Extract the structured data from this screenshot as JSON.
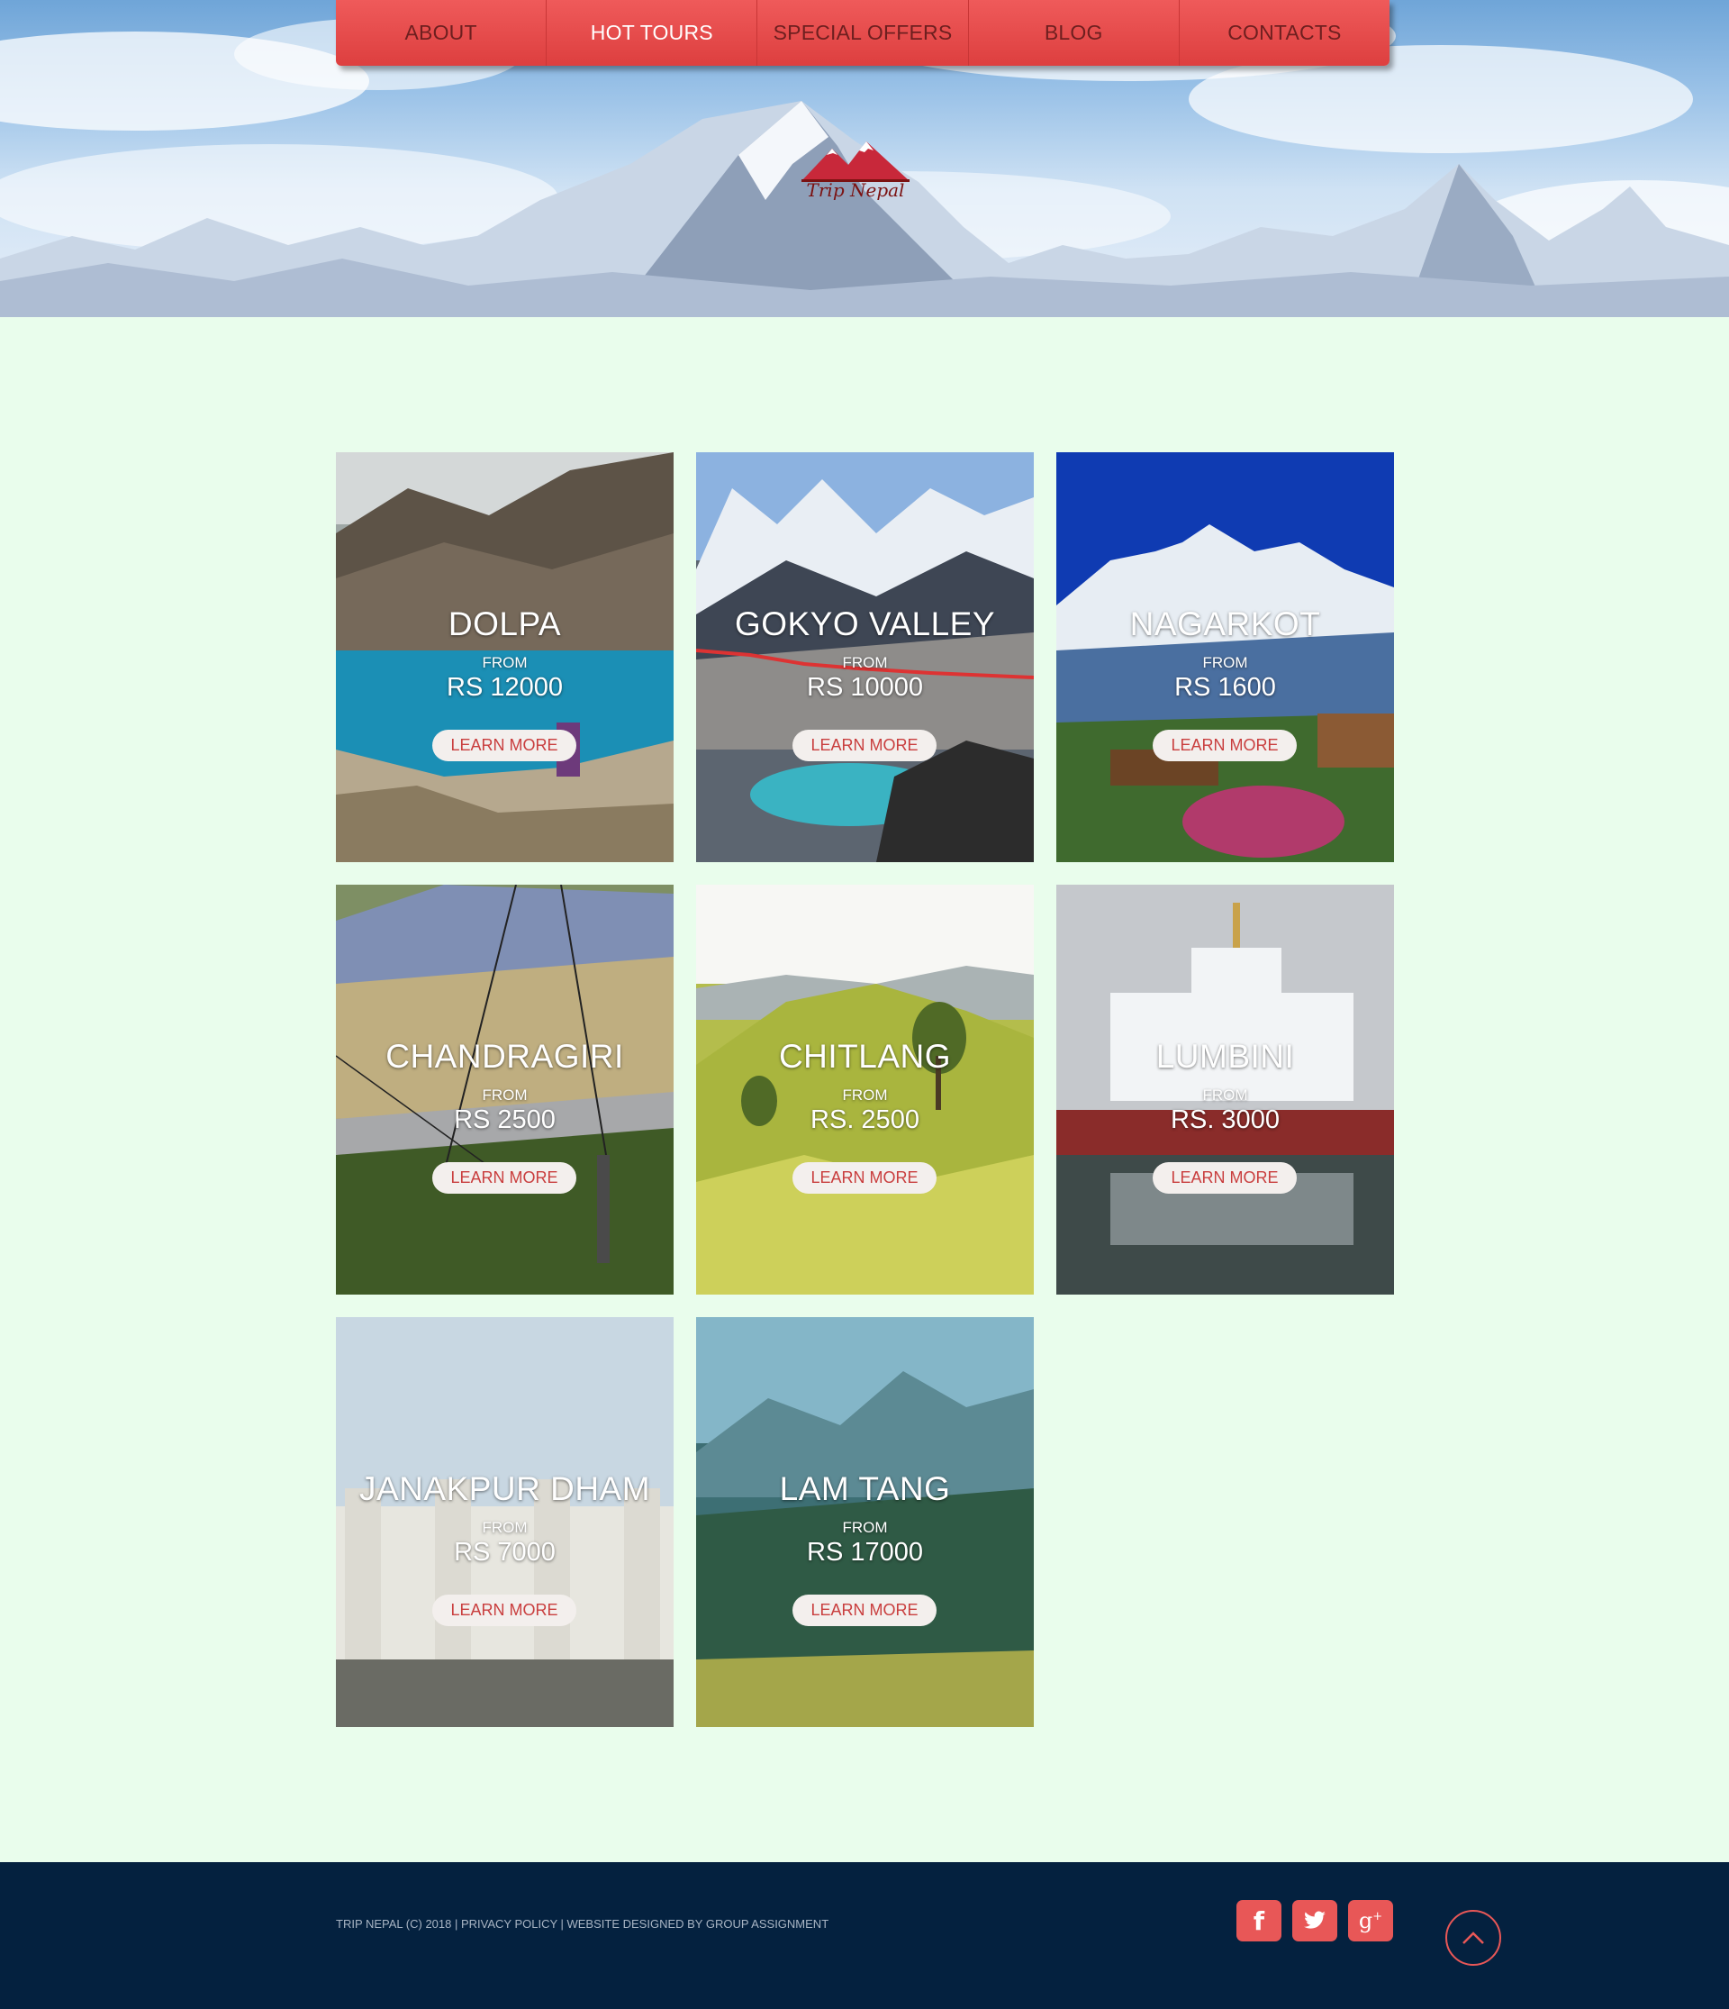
{
  "nav": {
    "items": [
      {
        "label": "ABOUT",
        "active": false
      },
      {
        "label": "HOT TOURS",
        "active": true
      },
      {
        "label": "SPECIAL OFFERS",
        "active": false
      },
      {
        "label": "BLOG",
        "active": false
      },
      {
        "label": "CONTACTS",
        "active": false
      }
    ]
  },
  "logo": {
    "text": "Trip Nepal",
    "icon": "mountain-logo-icon",
    "color": "#c8283a"
  },
  "tours": [
    {
      "title": "DOLPA",
      "from": "FROM",
      "price": "RS 12000",
      "button": "LEARN MORE"
    },
    {
      "title": "GOKYO VALLEY",
      "from": "FROM",
      "price": "RS 10000",
      "button": "LEARN MORE"
    },
    {
      "title": "NAGARKOT",
      "from": "FROM",
      "price": "RS 1600",
      "button": "LEARN MORE"
    },
    {
      "title": "CHANDRAGIRI",
      "from": "FROM",
      "price": "RS 2500",
      "button": "LEARN MORE"
    },
    {
      "title": "CHITLANG",
      "from": "FROM",
      "price": "RS. 2500",
      "button": "LEARN MORE"
    },
    {
      "title": "LUMBINI",
      "from": "FROM",
      "price": "RS. 3000",
      "button": "LEARN MORE"
    },
    {
      "title": "JANAKPUR DHAM",
      "from": "FROM",
      "price": "RS 7000",
      "button": "LEARN MORE"
    },
    {
      "title": "LAM TANG",
      "from": "FROM",
      "price": "RS 17000",
      "button": "LEARN MORE"
    }
  ],
  "footer": {
    "copyright": "TRIP NEPAL (C) 2018 | PRIVACY POLICY | WEBSITE DESIGNED BY GROUP ASSIGNMENT",
    "social": [
      "facebook-icon",
      "twitter-icon",
      "google-plus-icon"
    ],
    "back_to_top_icon": "chevron-up-icon"
  },
  "colors": {
    "accent": "#e85757",
    "nav_bg": "#e04444",
    "page_bg": "#e9fdec",
    "footer_bg": "#04213f"
  }
}
